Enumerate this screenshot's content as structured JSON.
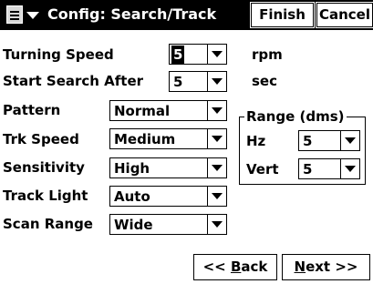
{
  "header": {
    "title": "Config: Search/Track",
    "finish_label": "Finish",
    "cancel_label": "Cancel"
  },
  "fields": {
    "turning_speed": {
      "label": "Turning Speed",
      "value": "5",
      "unit": "rpm"
    },
    "start_search_after": {
      "label": "Start Search After",
      "value": "5",
      "unit": "sec"
    },
    "pattern": {
      "label": "Pattern",
      "value": "Normal"
    },
    "trk_speed": {
      "label": "Trk Speed",
      "value": "Medium"
    },
    "sensitivity": {
      "label": "Sensitivity",
      "value": "High"
    },
    "track_light": {
      "label": "Track Light",
      "value": "Auto"
    },
    "scan_range": {
      "label": "Scan Range",
      "value": "Wide"
    }
  },
  "range": {
    "title": "Range (dms)",
    "hz": {
      "label": "Hz",
      "value": "5"
    },
    "vert": {
      "label": "Vert",
      "value": "5"
    }
  },
  "footer": {
    "back_prefix": "<< ",
    "back_accel": "B",
    "back_rest": "ack",
    "next_accel": "N",
    "next_rest": "ext >>"
  }
}
